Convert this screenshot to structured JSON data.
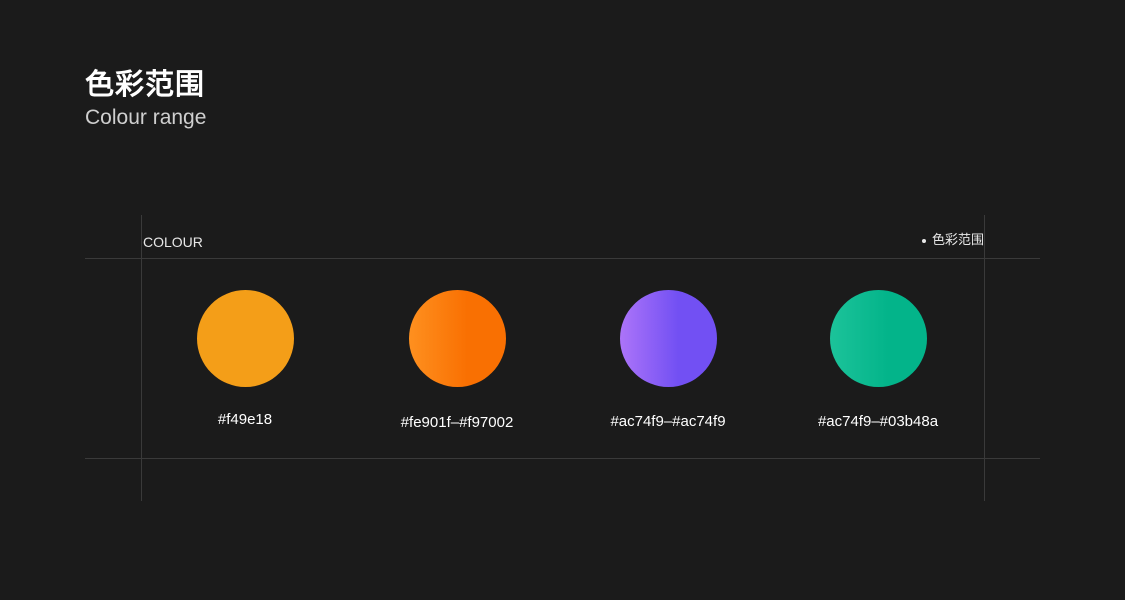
{
  "heading": {
    "title_cn": "色彩范围",
    "title_en": "Colour range"
  },
  "panel": {
    "left_label": "COLOUR",
    "right_label": "色彩范围"
  },
  "swatches": [
    {
      "label": "#f49e18",
      "color_start": "#f49e18",
      "color_end": "#f49e18"
    },
    {
      "label": "#fe901f–#f97002",
      "color_start": "#fe901f",
      "color_end": "#f97002"
    },
    {
      "label": "#ac74f9–#ac74f9",
      "color_start": "#ac74f9",
      "color_end": "#7250f3"
    },
    {
      "label": "#ac74f9–#03b48a",
      "color_start": "#1cc39a",
      "color_end": "#03b48a"
    }
  ]
}
